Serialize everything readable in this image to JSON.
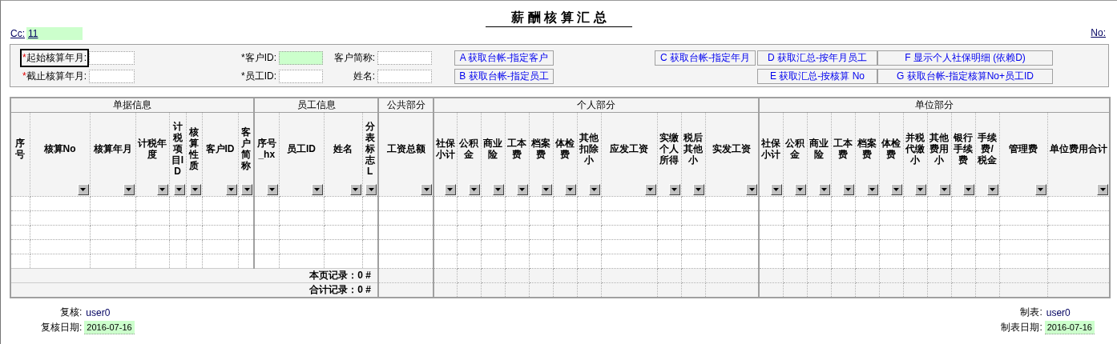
{
  "title": "薪 酬 核 算 汇 总",
  "cc": {
    "label": "Cc:",
    "value": "11"
  },
  "no": {
    "label": "No:"
  },
  "filters": [
    {
      "mark": "*",
      "required": true,
      "label": "起始核算年月:",
      "selected": true,
      "highlighted": false
    },
    {
      "mark": "*",
      "required": false,
      "label": "客户ID:",
      "selected": false,
      "highlighted": true
    },
    {
      "label": "客户简称:",
      "selected": false,
      "highlighted": false
    },
    {
      "mark": "*",
      "required": true,
      "label": "截止核算年月:",
      "selected": false,
      "highlighted": false
    },
    {
      "mark": "*",
      "required": false,
      "label": "员工ID:",
      "selected": false,
      "highlighted": false
    },
    {
      "label": "姓名:",
      "selected": false,
      "highlighted": false
    }
  ],
  "buttons": [
    "A 获取台帐-指定客户",
    "C 获取台帐-指定年月",
    "D 获取汇总-按年月员工",
    "F 显示个人社保明细 (依赖D)",
    "B 获取台帐-指定员工",
    "E 获取汇总-按核算  No",
    "G 获取台帐-指定核算No+员工ID"
  ],
  "column_groups": [
    {
      "label": "单据信息",
      "columns": [
        {
          "label": "序号",
          "filterable": false
        },
        {
          "label": "核算No",
          "filterable": true
        },
        {
          "label": "核算年月",
          "filterable": true
        },
        {
          "label": "计税年度",
          "filterable": true
        },
        {
          "label": "计税项目ID",
          "filterable": true
        },
        {
          "label": "核算性质",
          "filterable": true
        },
        {
          "label": "客户ID",
          "filterable": true
        },
        {
          "label": "客户简称",
          "filterable": true
        }
      ]
    },
    {
      "label": "员工信息",
      "columns": [
        {
          "label": "序号_hx",
          "filterable": true
        },
        {
          "label": "员工ID",
          "filterable": true
        },
        {
          "label": "姓名",
          "filterable": true
        },
        {
          "label": "分表标志L",
          "filterable": true
        }
      ]
    },
    {
      "label": "公共部分",
      "columns": [
        {
          "label": "工资总额",
          "filterable": true
        }
      ]
    },
    {
      "label": "个人部分",
      "columns": [
        {
          "label": "社保小计",
          "filterable": true
        },
        {
          "label": "公积金",
          "filterable": true
        },
        {
          "label": "商业险",
          "filterable": true
        },
        {
          "label": "工本费",
          "filterable": true
        },
        {
          "label": "档案费",
          "filterable": true
        },
        {
          "label": "体检费",
          "filterable": true
        },
        {
          "label": "其他扣除小",
          "filterable": true
        },
        {
          "label": "应发工资",
          "filterable": true
        },
        {
          "label": "实缴个人所得",
          "filterable": true
        },
        {
          "label": "税后其他小",
          "filterable": true
        },
        {
          "label": "实发工资",
          "filterable": true
        }
      ]
    },
    {
      "label": "单位部分",
      "columns": [
        {
          "label": "社保小计",
          "filterable": true
        },
        {
          "label": "公积金",
          "filterable": true
        },
        {
          "label": "商业险",
          "filterable": true
        },
        {
          "label": "工本费",
          "filterable": true
        },
        {
          "label": "档案费",
          "filterable": true
        },
        {
          "label": "体检费",
          "filterable": true
        },
        {
          "label": "并税代缴小",
          "filterable": true
        },
        {
          "label": "其他费用小",
          "filterable": true
        },
        {
          "label": "银行手续费",
          "filterable": true
        },
        {
          "label": "手续费/税金",
          "filterable": true
        },
        {
          "label": "管理费",
          "filterable": true
        },
        {
          "label": "单位费用合计",
          "filterable": true
        }
      ]
    }
  ],
  "summary": [
    "本页记录：0 #",
    "合计记录：0 #"
  ],
  "footer_left": [
    {
      "label": "复核:",
      "value": "user0",
      "highlighted": false
    },
    {
      "label": "复核日期:",
      "value": "2016-07-16",
      "highlighted": true
    }
  ],
  "footer_right": [
    {
      "label": "制表:",
      "value": "user0",
      "highlighted": false
    },
    {
      "label": "制表日期:",
      "value": "2016-07-16",
      "highlighted": true
    }
  ]
}
